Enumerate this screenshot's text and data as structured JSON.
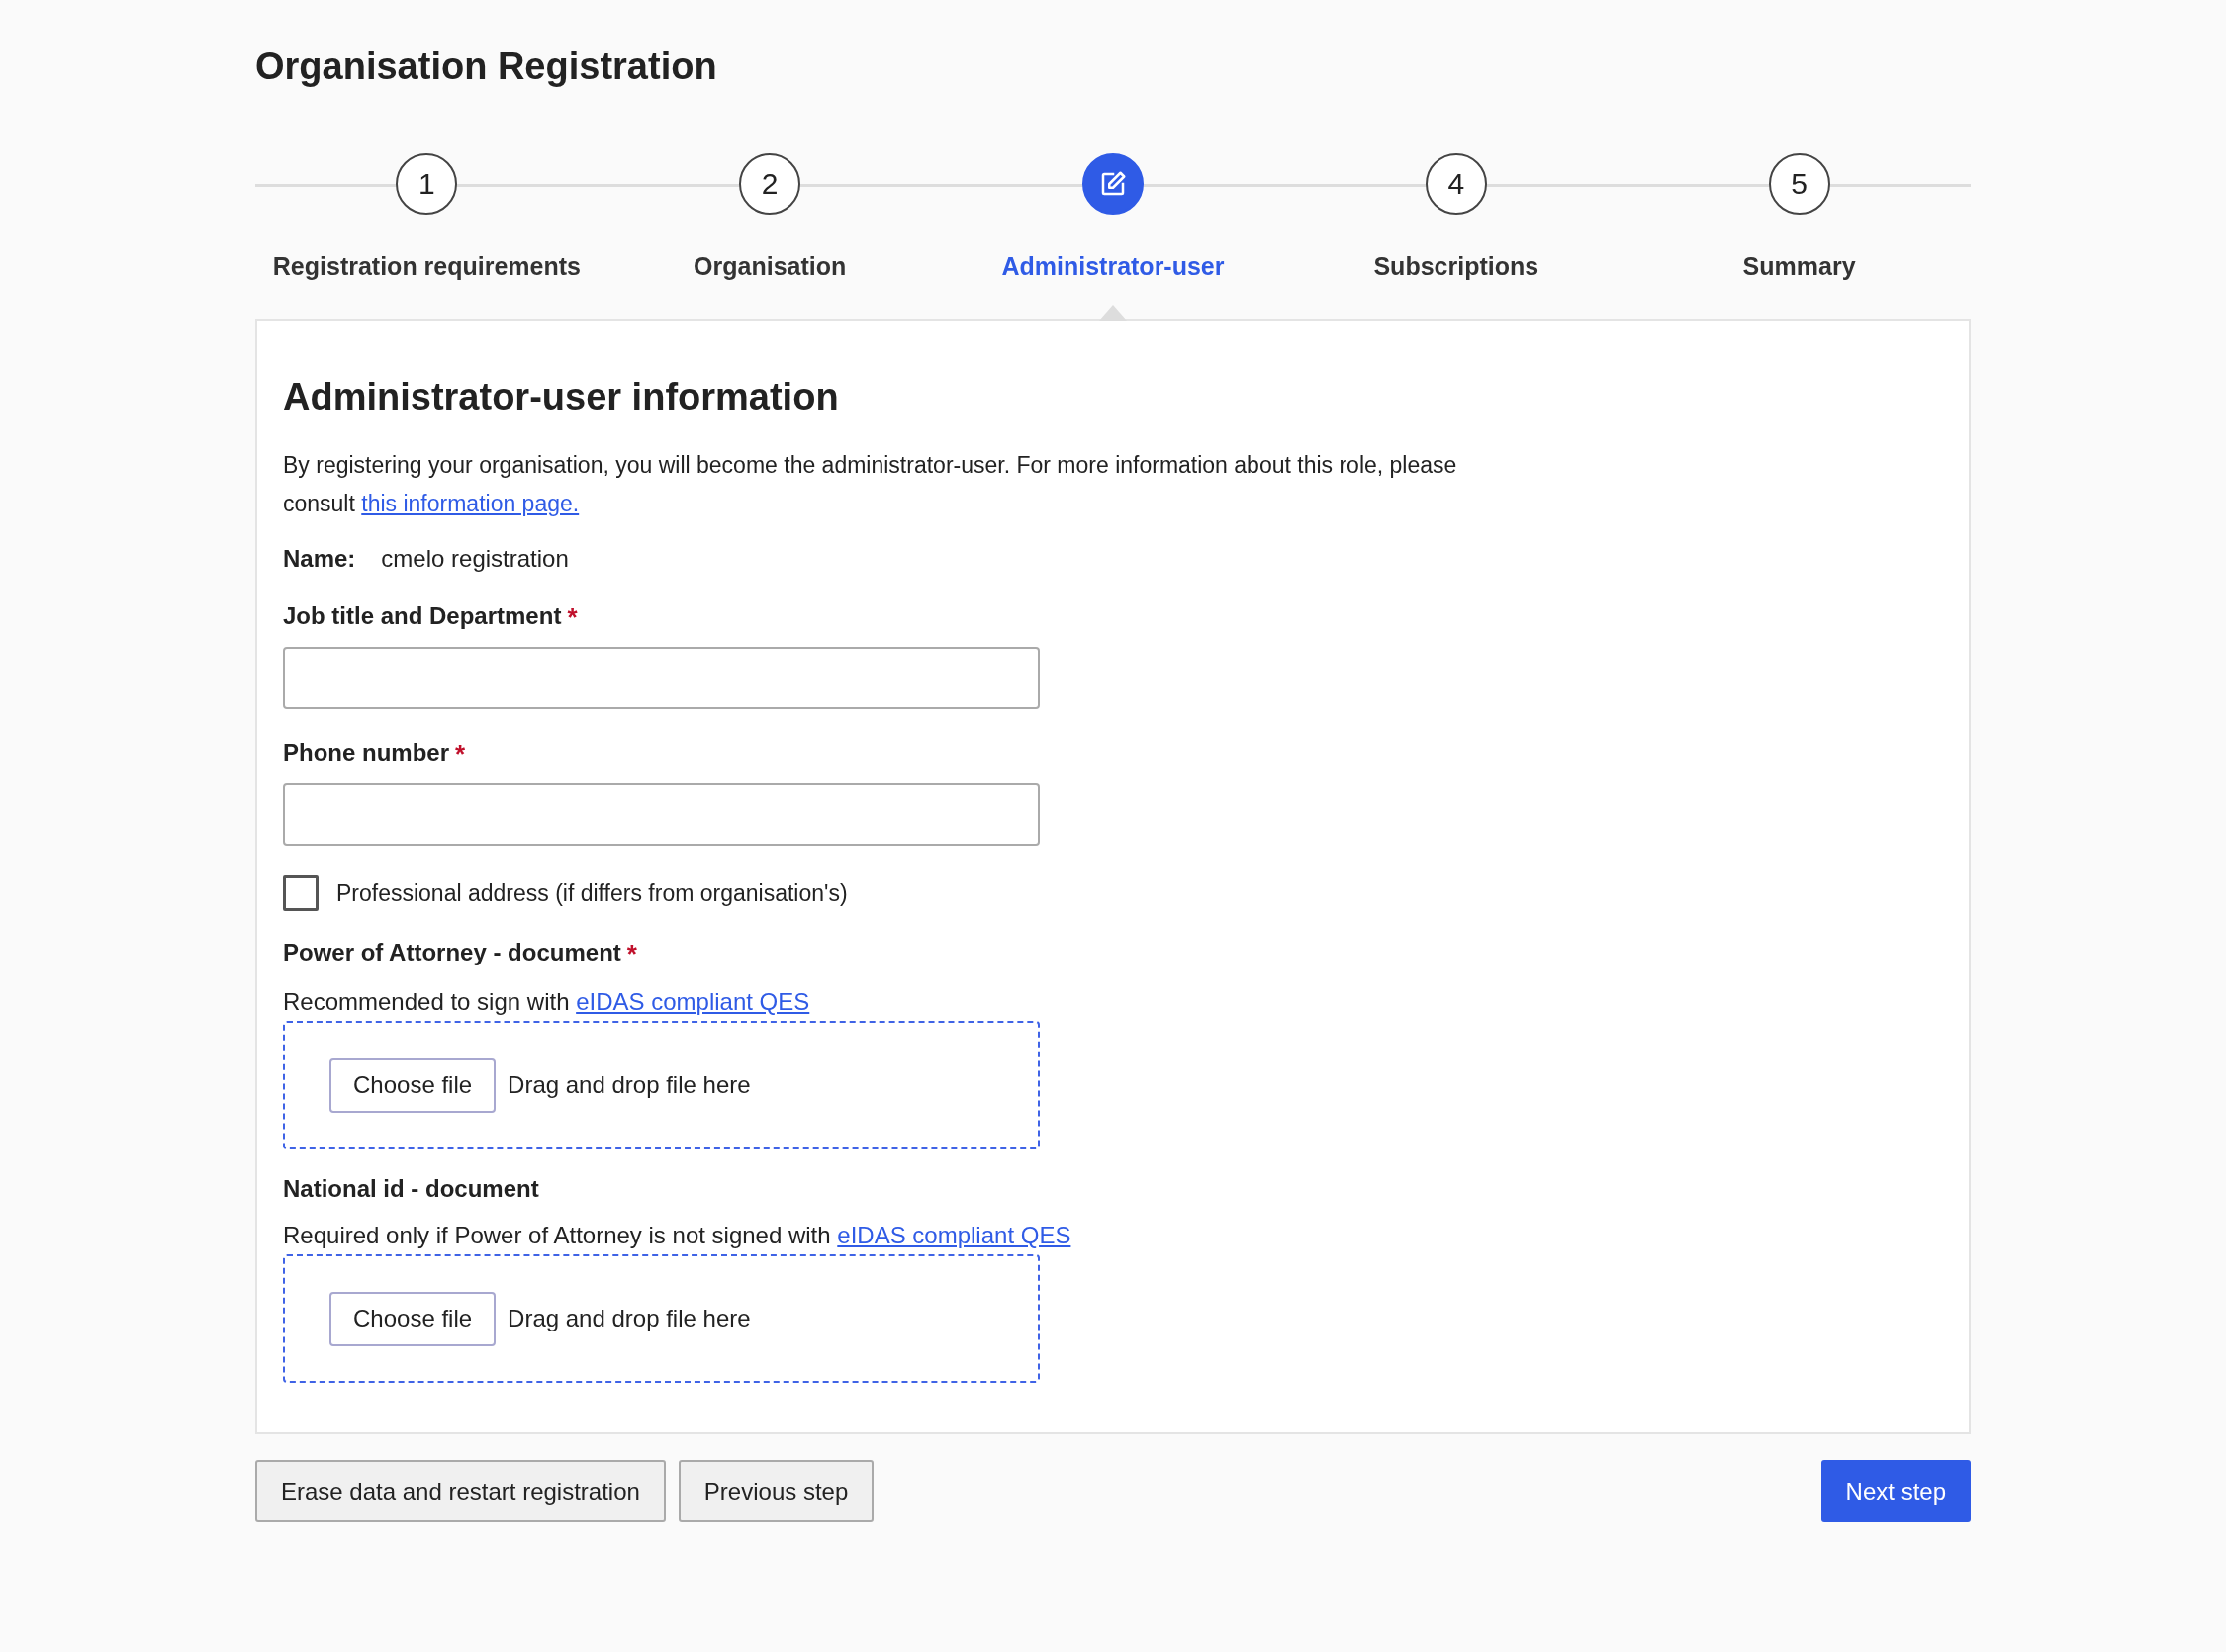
{
  "page_title": "Organisation Registration",
  "steps": [
    {
      "number": "1",
      "label": "Registration requirements",
      "selected": false
    },
    {
      "number": "2",
      "label": "Organisation",
      "selected": false
    },
    {
      "label": "Administrator-user",
      "selected": true
    },
    {
      "number": "4",
      "label": "Subscriptions",
      "selected": false
    },
    {
      "number": "5",
      "label": "Summary",
      "selected": false
    }
  ],
  "section": {
    "heading": "Administrator-user information",
    "intro": [
      {
        "kind": "text",
        "text": "By registering your organisation, you will become the administrator-user. For more information about this role, please consult "
      },
      {
        "kind": "link",
        "text": "this information page."
      }
    ],
    "name_label": "Name:",
    "name_value": "cmelo registration",
    "fields": [
      {
        "kind": "input",
        "label": "Job title and Department",
        "required_mark": "*"
      },
      {
        "kind": "input",
        "label": "Phone number",
        "required_mark": "*"
      },
      {
        "kind": "checkbox",
        "label": "Professional address (if differs from organisation's)",
        "checked": false
      },
      {
        "kind": "file",
        "label": "Power of Attorney - document",
        "required_mark": "*",
        "hint": [
          {
            "kind": "text",
            "text": "Recommended to sign with "
          },
          {
            "kind": "link",
            "text": "eIDAS compliant QES"
          }
        ],
        "button": "Choose file",
        "drop_text": "Drag and drop file here"
      },
      {
        "kind": "file",
        "label": "National id - document",
        "hint": [
          {
            "kind": "text",
            "text": "Required only if Power of Attorney is not signed with "
          },
          {
            "kind": "link",
            "text": "eIDAS compliant QES"
          }
        ],
        "button": "Choose file",
        "drop_text": "Drag and drop file here"
      }
    ]
  },
  "footer": {
    "left_buttons": [
      "Erase data and restart registration",
      "Previous step"
    ],
    "primary_button": "Next step"
  }
}
